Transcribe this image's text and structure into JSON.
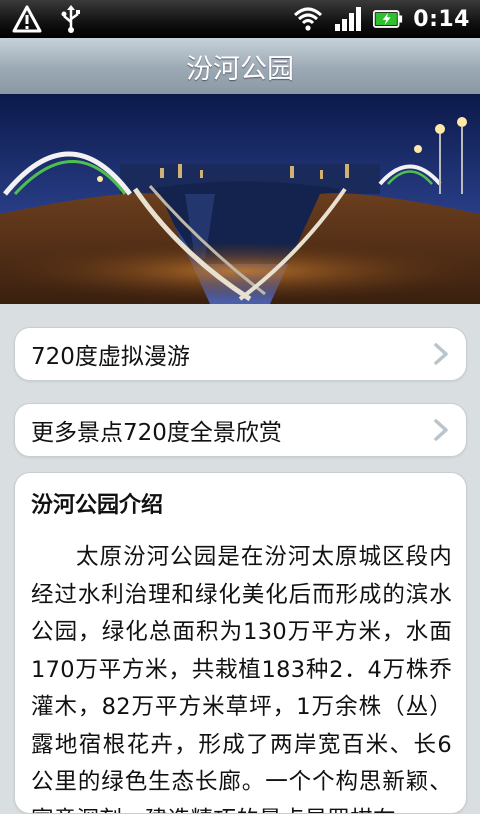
{
  "status_bar": {
    "time": "0:14",
    "icons": [
      "warning-icon",
      "usb-icon",
      "wifi-icon",
      "signal-icon",
      "battery-charging-icon"
    ]
  },
  "header": {
    "title": "汾河公园"
  },
  "hero": {
    "icon": "panorama-image"
  },
  "menu": {
    "items": [
      {
        "label": "720度虚拟漫游"
      },
      {
        "label": "更多景点720度全景欣赏"
      }
    ]
  },
  "intro": {
    "heading": "汾河公园介绍",
    "body": "太原汾河公园是在汾河太原城区段内经过水利治理和绿化美化后而形成的滨水公园，绿化总面积为130万平方米，水面170万平方米，共栽植183种2．4万株乔灌木，82万平方米草坪，1万余株（丛）露地宿根花卉，形成了两岸宽百米、长6公里的绿色生态长廊。一个个构思新颖、寓意深刻、建造精巧的景点星罗棋布"
  }
}
